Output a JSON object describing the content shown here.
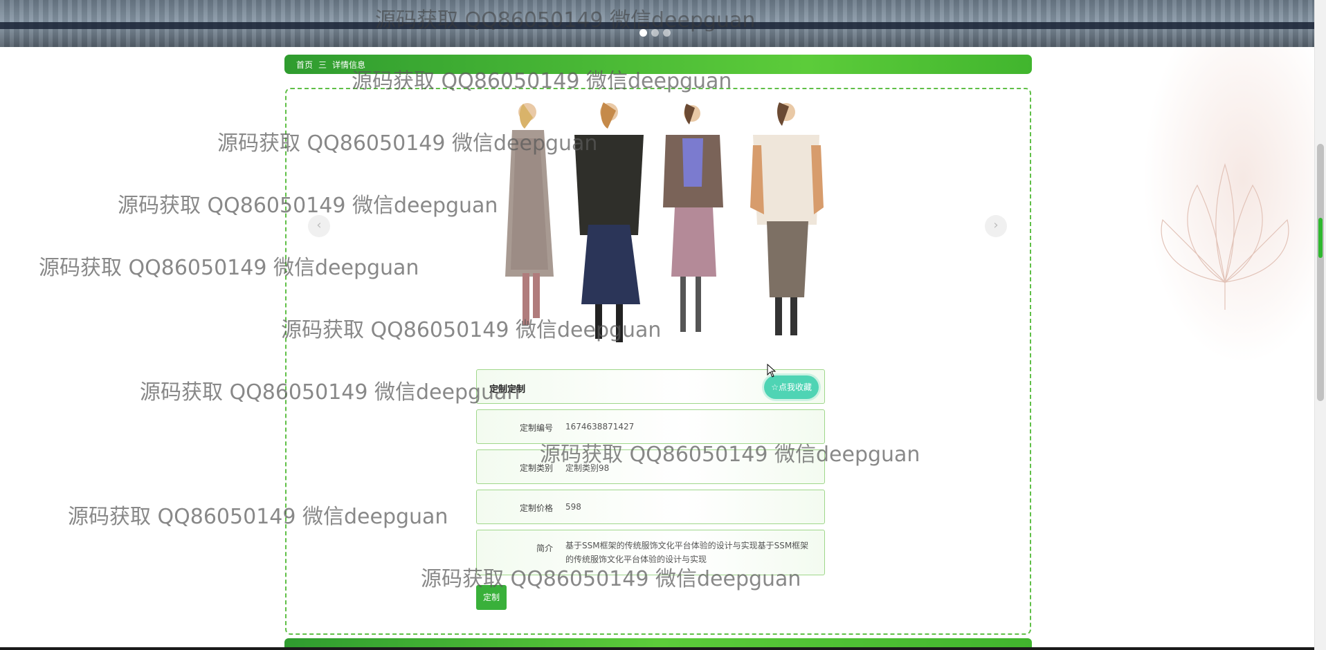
{
  "banner": {
    "dots": 3,
    "active_dot": 0
  },
  "breadcrumb": {
    "home": "首页",
    "separator": "三",
    "current": "详情信息"
  },
  "detail": {
    "title": "定制定制",
    "favorite_label": "☆点我收藏",
    "fields": [
      {
        "label": "定制编号",
        "value": "1674638871427"
      },
      {
        "label": "定制类别",
        "value": "定制类别98"
      },
      {
        "label": "定制价格",
        "value": "598"
      },
      {
        "label": "简介",
        "value": "基于SSM框架的传统服饰文化平台体验的设计与实现基于SSM框架的传统服饰文化平台体验的设计与实现"
      }
    ],
    "submit_label": "定制"
  },
  "carousel": {
    "prev": "‹",
    "next": "›"
  },
  "watermark": "源码获取 QQ86050149 微信deepguan",
  "colors": {
    "accent": "#39b03a",
    "favorite": "#4fd4b4",
    "border": "#5fbf46"
  }
}
